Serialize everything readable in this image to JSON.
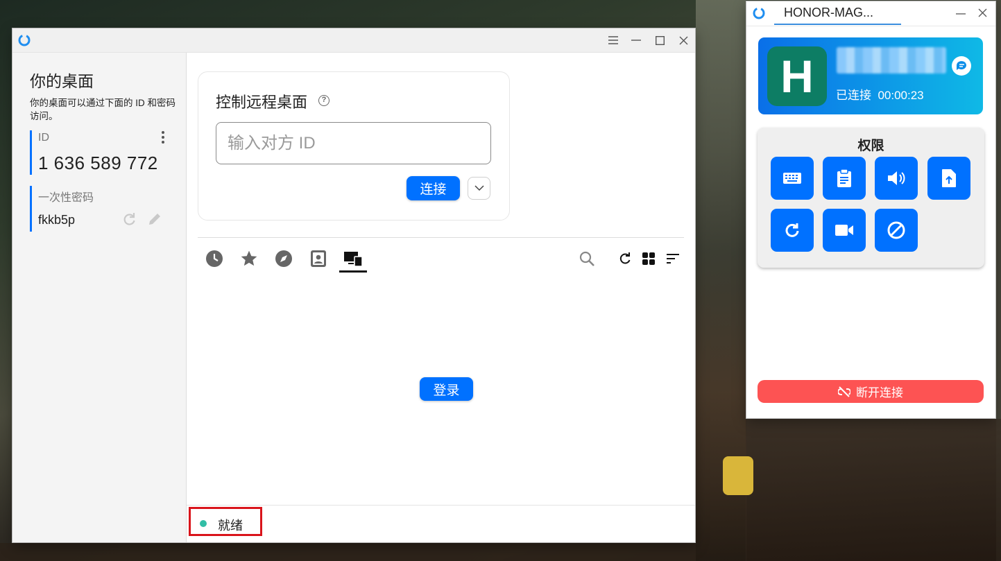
{
  "main_window": {
    "left": {
      "title": "你的桌面",
      "description": "你的桌面可以通过下面的 ID 和密码访问。",
      "id_label": "ID",
      "id_value": "1 636 589 772",
      "password_label": "一次性密码",
      "password_value": "fkkb5p"
    },
    "remote_card": {
      "title": "控制远程桌面",
      "input_placeholder": "输入对方 ID",
      "connect_label": "连接"
    },
    "tabs": [
      "recent-sessions-icon",
      "favorites-icon",
      "discovered-icon",
      "address-book-icon",
      "accessible-devices-icon"
    ],
    "login_label": "登录",
    "status": {
      "text": "就绪",
      "color": "#32bea6"
    }
  },
  "conn_window": {
    "tab_title": "HONOR-MAG...",
    "avatar_letter": "H",
    "status_text": "已连接  00:00:23",
    "permissions_title": "权限",
    "permission_icons": [
      "keyboard-icon",
      "clipboard-icon",
      "audio-icon",
      "file-transfer-icon",
      "restart-icon",
      "recording-icon",
      "block-input-icon"
    ],
    "disconnect_label": "断开连接"
  },
  "colors": {
    "accent": "#0071ff",
    "danger": "#fd5353",
    "avatar": "#0d7d64"
  }
}
